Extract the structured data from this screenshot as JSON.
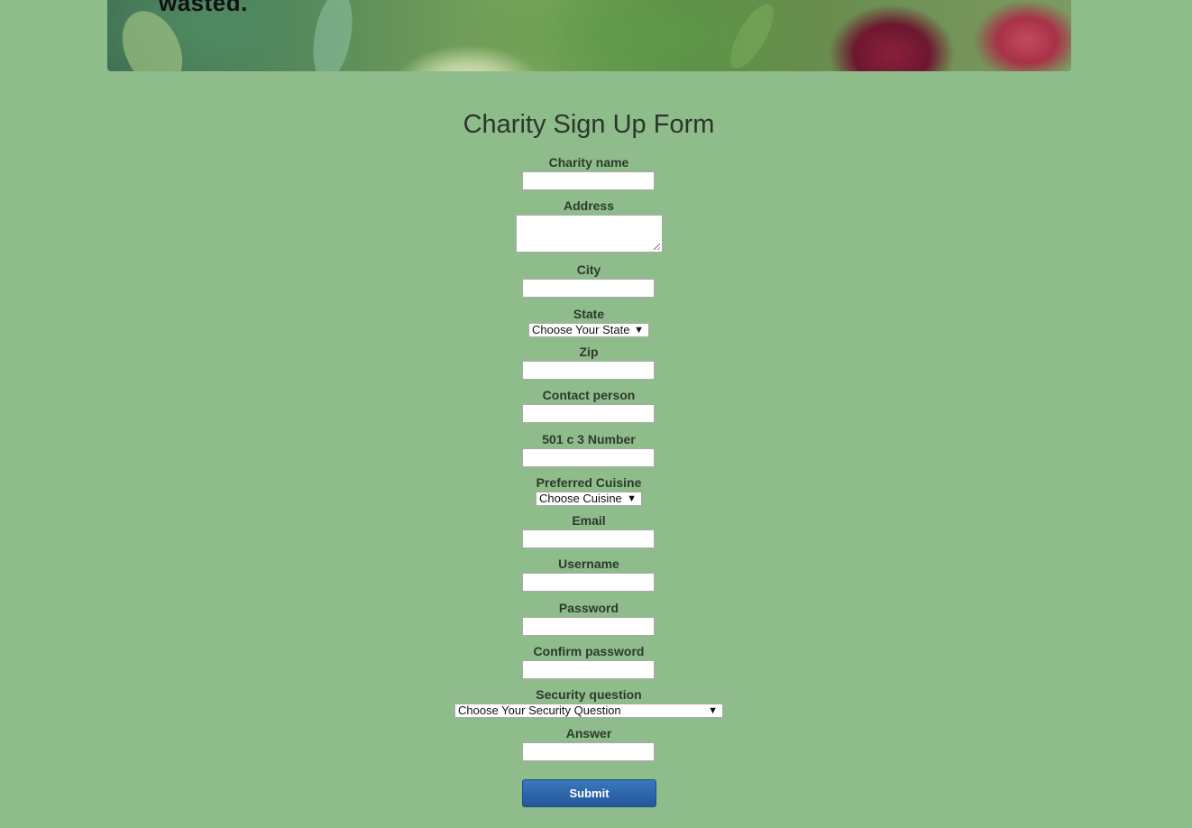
{
  "hero": {
    "tagline_fragment": "wasted."
  },
  "form": {
    "title": "Charity Sign Up Form",
    "fields": {
      "charity_name": {
        "label": "Charity name",
        "value": ""
      },
      "address": {
        "label": "Address",
        "value": ""
      },
      "city": {
        "label": "City",
        "value": ""
      },
      "state": {
        "label": "State",
        "selected": "Choose Your State"
      },
      "zip": {
        "label": "Zip",
        "value": ""
      },
      "contact_person": {
        "label": "Contact person",
        "value": ""
      },
      "tax_number": {
        "label": "501 c 3 Number",
        "value": ""
      },
      "cuisine": {
        "label": "Preferred Cuisine",
        "selected": "Choose Cuisine"
      },
      "email": {
        "label": "Email",
        "value": ""
      },
      "username": {
        "label": "Username",
        "value": ""
      },
      "password": {
        "label": "Password",
        "value": ""
      },
      "confirm_password": {
        "label": "Confirm password",
        "value": ""
      },
      "security_question": {
        "label": "Security question",
        "selected": "Choose Your Security Question"
      },
      "answer": {
        "label": "Answer",
        "value": ""
      }
    },
    "submit_label": "Submit"
  },
  "icons": {
    "dropdown": "chevron-down-icon",
    "resize": "resize-grip-icon"
  },
  "colors": {
    "page_background": "#8fbc8b",
    "submit_button": "#2d66a8"
  }
}
